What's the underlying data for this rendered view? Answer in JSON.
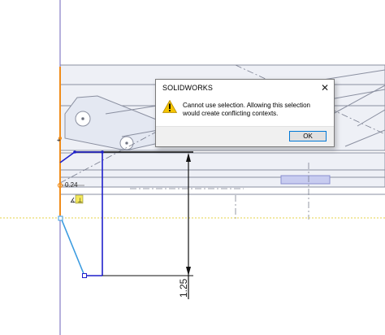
{
  "sketch": {
    "dimension_vertical": "1.25",
    "dimension_small": "0.24",
    "relation_glyph": "⊥"
  },
  "dialog": {
    "title": "SOLIDWORKS",
    "close_glyph": "✕",
    "icon": "warning-icon",
    "message": "Cannot use selection. Allowing this selection would create conflicting contexts.",
    "ok_label": "OK"
  },
  "colors": {
    "sketch_blue": "#1f1fcc",
    "selected_blue": "#3b9be0",
    "origin_orange": "#f08c1a",
    "part_fill": "#e4e8f2",
    "part_line": "#8a8fa0",
    "warning_yellow": "#f5c400"
  }
}
